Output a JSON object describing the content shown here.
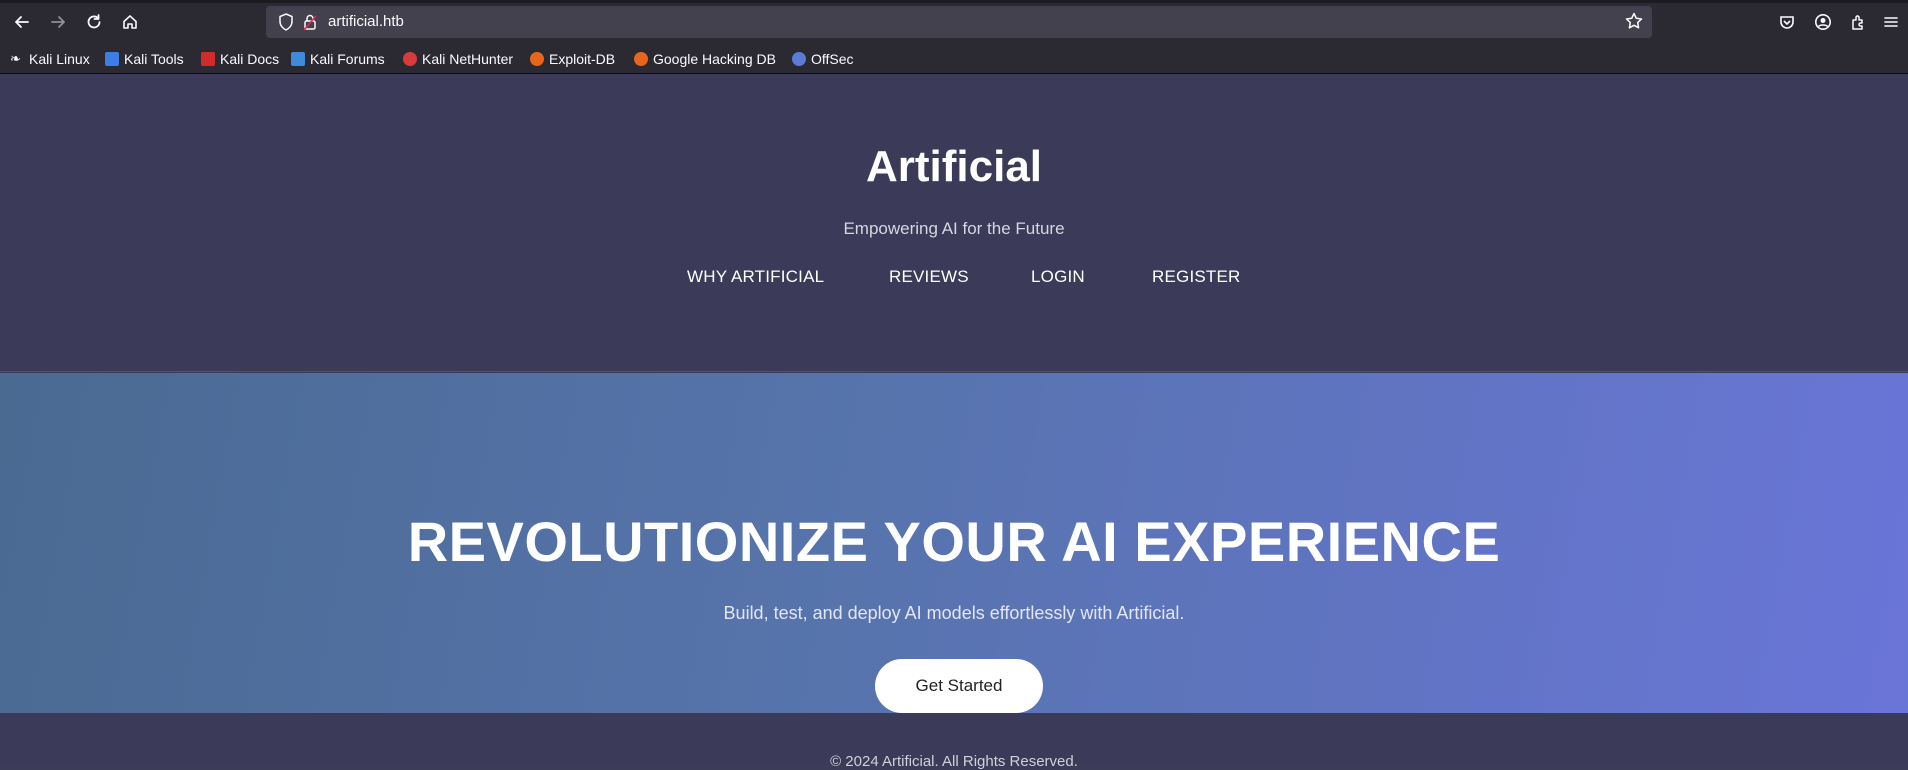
{
  "browser": {
    "url": "artificial.htb",
    "icons": [
      "back-arrow-icon",
      "forward-arrow-icon",
      "reload-icon",
      "home-icon",
      "shield-icon",
      "lock-icon",
      "star-icon",
      "pocket-icon",
      "account-icon",
      "extensions-icon",
      "menu-icon"
    ]
  },
  "bookmarks": [
    {
      "label": "Kali Linux",
      "icon": "kali-dragon-icon"
    },
    {
      "label": "Kali Tools",
      "icon": "kali-tools-icon"
    },
    {
      "label": "Kali Docs",
      "icon": "kali-docs-icon"
    },
    {
      "label": "Kali Forums",
      "icon": "kali-forums-icon"
    },
    {
      "label": "Kali NetHunter",
      "icon": "nethunter-icon"
    },
    {
      "label": "Exploit-DB",
      "icon": "exploit-db-icon"
    },
    {
      "label": "Google Hacking DB",
      "icon": "ghdb-icon"
    },
    {
      "label": "OffSec",
      "icon": "offsec-icon"
    }
  ],
  "header": {
    "title": "Artificial",
    "tagline": "Empowering AI for the Future",
    "nav": [
      "WHY ARTIFICIAL",
      "REVIEWS",
      "LOGIN",
      "REGISTER"
    ]
  },
  "hero": {
    "title": "REVOLUTIONIZE YOUR AI EXPERIENCE",
    "subtitle": "Build, test, and deploy AI models effortlessly with Artificial.",
    "cta_label": "Get Started"
  },
  "footer": {
    "text": "© 2024 Artificial. All Rights Reserved."
  },
  "colors": {
    "header_bg": "#3b3a58",
    "hero_gradient_start": "#4a6a92",
    "hero_gradient_end": "#6a75d8",
    "browser_chrome": "#2b2a33"
  }
}
